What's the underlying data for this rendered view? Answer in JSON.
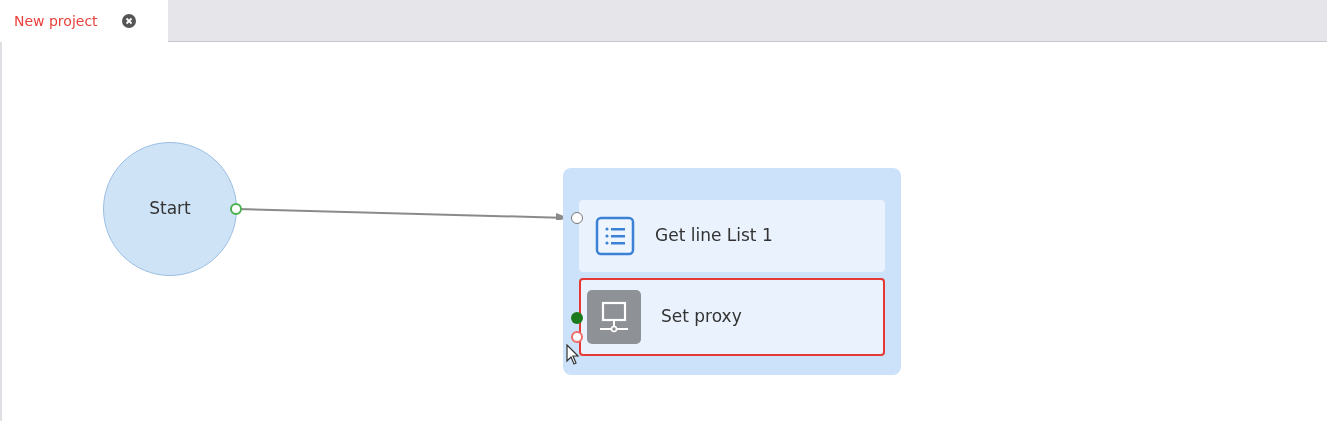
{
  "tabs": [
    {
      "label": "New project",
      "selected": true
    }
  ],
  "start_node": {
    "label": "Start"
  },
  "group": {
    "actions": [
      {
        "label": "Get line List 1",
        "kind": "list",
        "selected": false
      },
      {
        "label": "Set proxy",
        "kind": "proxy",
        "selected": true
      }
    ]
  }
}
